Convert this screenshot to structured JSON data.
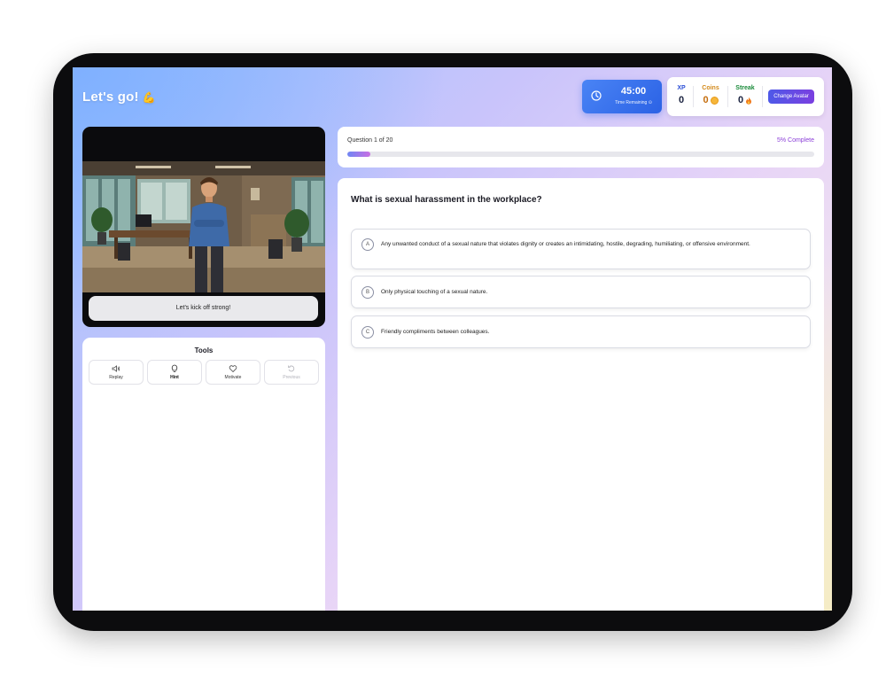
{
  "header": {
    "greeting": "Let's go!",
    "greeting_emoji": "💪"
  },
  "timer": {
    "value": "45:00",
    "label": "Time Remaining ⊙",
    "icon": "clock-icon"
  },
  "stats": {
    "xp": {
      "label": "XP",
      "value": "0"
    },
    "coins": {
      "label": "Coins",
      "value": "0",
      "icon": "coin-icon"
    },
    "streak": {
      "label": "Streak",
      "value": "0",
      "icon": "flame-icon"
    },
    "change_avatar_label": "Change Avatar"
  },
  "video": {
    "caption": "Let's kick off strong!"
  },
  "tools": {
    "title": "Tools",
    "items": [
      {
        "label": "Replay",
        "icon": "speaker-icon",
        "enabled": true
      },
      {
        "label": "Hint",
        "icon": "lightbulb-icon",
        "enabled": true
      },
      {
        "label": "Motivate",
        "icon": "heart-icon",
        "enabled": true
      },
      {
        "label": "Previous",
        "icon": "undo-icon",
        "enabled": false
      }
    ]
  },
  "progress": {
    "label": "Question 1 of 20",
    "percent_label": "5% Complete",
    "percent": 5
  },
  "question": {
    "text": "What is sexual harassment in the workplace?",
    "options": [
      {
        "letter": "A",
        "text": "Any unwanted conduct of a sexual nature that violates dignity or creates an intimidating, hostile, degrading, humiliating, or offensive environment."
      },
      {
        "letter": "B",
        "text": "Only physical touching of a sexual nature."
      },
      {
        "letter": "C",
        "text": "Friendly compliments between colleagues."
      }
    ]
  },
  "colors": {
    "accent_blue": "#2b62e5",
    "accent_purple": "#8b3ed8",
    "coins": "#d38a1b",
    "streak": "#1a8a3a"
  }
}
